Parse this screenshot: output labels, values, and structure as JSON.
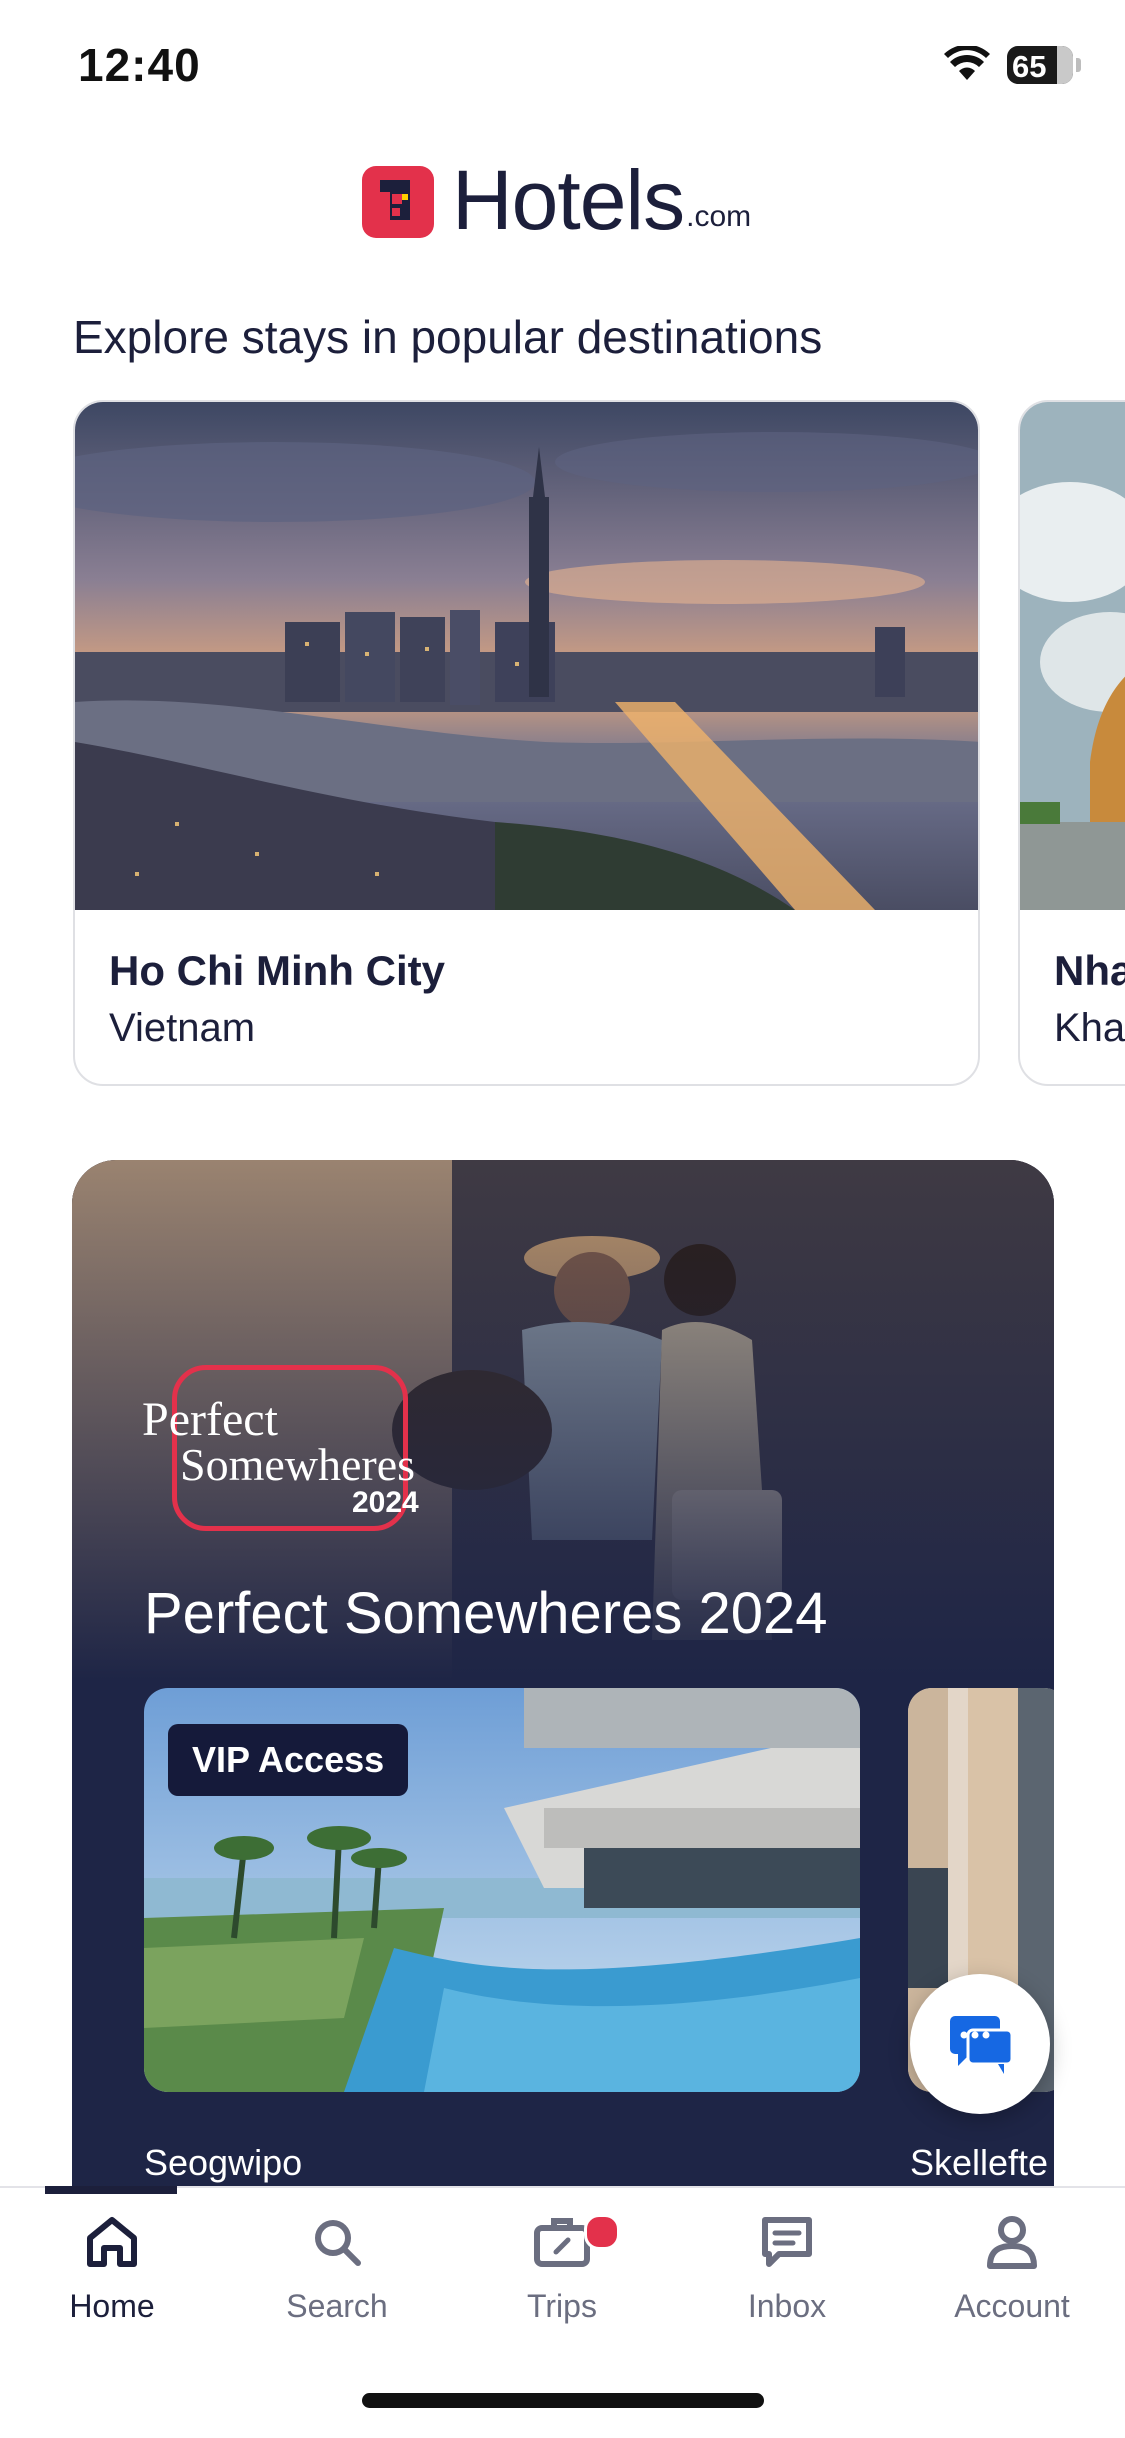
{
  "status_bar": {
    "time": "12:40",
    "battery": "65"
  },
  "brand": {
    "name": "Hotels",
    "suffix": ".com"
  },
  "destinations_section": {
    "title": "Explore stays in popular destinations",
    "cards": [
      {
        "city": "Ho Chi Minh City",
        "country": "Vietnam"
      },
      {
        "city": "Nha",
        "country": "Kha"
      }
    ]
  },
  "promo": {
    "badge": {
      "line1": "Perfect",
      "line2": "Somewheres",
      "year": "2024"
    },
    "title": "Perfect Somewheres 2024",
    "hotels": [
      {
        "badge": "VIP Access",
        "location": "Seogwipo"
      },
      {
        "location": "Skellefte"
      }
    ]
  },
  "tabs": [
    {
      "label": "Home",
      "icon": "home-icon",
      "active": true
    },
    {
      "label": "Search",
      "icon": "search-icon",
      "active": false
    },
    {
      "label": "Trips",
      "icon": "briefcase-icon",
      "active": false
    },
    {
      "label": "Inbox",
      "icon": "message-icon",
      "active": false
    },
    {
      "label": "Account",
      "icon": "person-icon",
      "active": false
    }
  ],
  "colors": {
    "brand_red": "#e3314b",
    "navy": "#1c1f3b"
  }
}
